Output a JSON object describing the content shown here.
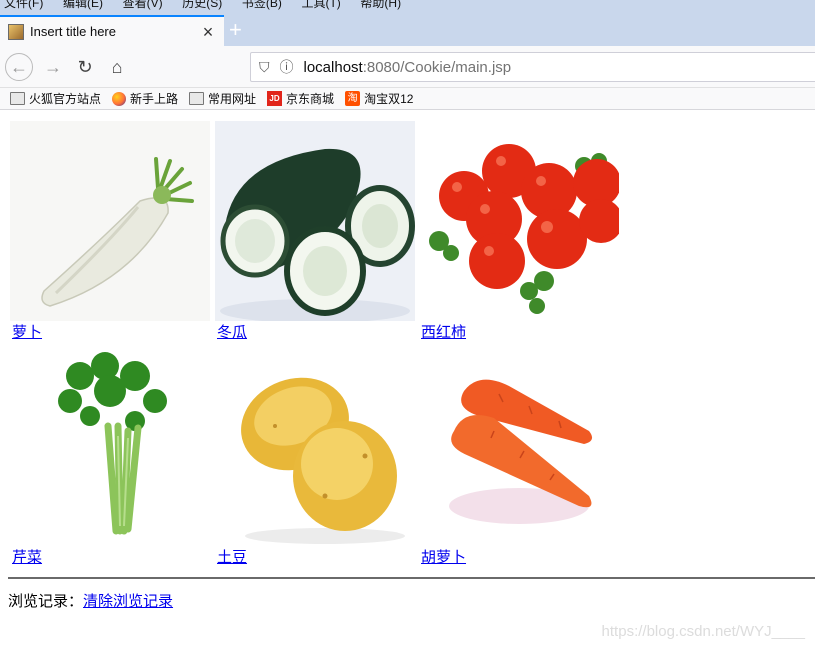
{
  "browser": {
    "menu": [
      "文件(F)",
      "编辑(E)",
      "查看(V)",
      "历史(S)",
      "书签(B)",
      "工具(T)",
      "帮助(H)"
    ],
    "tab_title": "Insert title here",
    "new_tab": "+",
    "url_host": "localhost",
    "url_rest": ":8080/Cookie/main.jsp",
    "bookmarks": [
      "火狐官方站点",
      "新手上路",
      "常用网址",
      "京东商城",
      "淘宝双12"
    ]
  },
  "products": [
    {
      "name": "萝卜"
    },
    {
      "name": "冬瓜"
    },
    {
      "name": "西红柿"
    },
    {
      "name": "芹菜"
    },
    {
      "name": "土豆"
    },
    {
      "name": "胡萝卜"
    }
  ],
  "history": {
    "label": "浏览记录：",
    "clear_link": "清除浏览记录"
  },
  "watermark": "https://blog.csdn.net/WYJ____"
}
